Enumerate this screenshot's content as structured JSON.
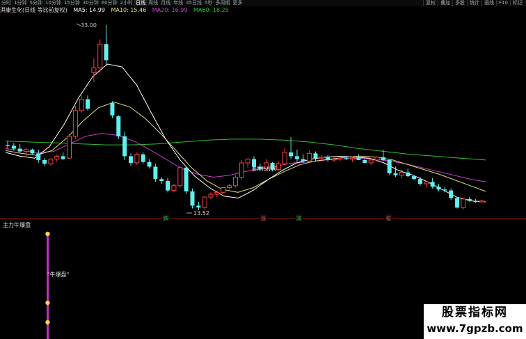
{
  "toolbar": {
    "tabs": [
      "分时",
      "1分钟",
      "5分钟",
      "10分钟",
      "15分钟",
      "30分钟",
      "60分钟",
      "2小时",
      "日线",
      "周线",
      "月线",
      "年线",
      "45日线",
      "5秒",
      "多周期",
      "更多"
    ],
    "active_tab": 8,
    "right_buttons": [
      "复权",
      "叠加",
      "多股",
      "统计",
      "画线",
      "F10",
      "标记"
    ]
  },
  "legend": {
    "stock_name": "湃康生化(日线 等比前复权)",
    "ma5": "MA5: 14.99",
    "ma10": "MA10: 15.46",
    "ma20": "MA20: 16.99",
    "ma60": "MA60: 18.25",
    "colors": {
      "ma5": "#ffffff",
      "ma10": "#e8e07a",
      "ma20": "#d040d0",
      "ma60": "#30c030"
    }
  },
  "annotations": {
    "high_label": "33.00",
    "low_label": "13.52",
    "watermark_small": "股神指标网"
  },
  "signals": [
    {
      "text": "跌",
      "color": "#30c030"
    },
    {
      "text": "涨",
      "color": "#e05050"
    },
    {
      "text": "减",
      "color": "#30c030"
    },
    {
      "text": "稳",
      "color": "#e05050"
    }
  ],
  "indicator": {
    "title": "主力牛爆盘",
    "label": "\"牛爆盘\"",
    "bar_color": "#c030c0"
  },
  "watermark": {
    "line1": "股票指标网",
    "line2": "www.7gpzb.com"
  },
  "chart_data": {
    "type": "candlestick",
    "up_color": "#ff4040",
    "down_color": "#60f0f0",
    "highest_label": 33.0,
    "lowest_label": 13.52,
    "ohlc": [
      [
        20.4,
        20.8,
        20.0,
        20.3
      ],
      [
        20.3,
        20.6,
        19.8,
        20.0
      ],
      [
        20.0,
        20.5,
        19.6,
        19.7
      ],
      [
        19.7,
        20.1,
        19.2,
        19.9
      ],
      [
        19.9,
        20.0,
        19.4,
        19.5
      ],
      [
        19.5,
        19.9,
        18.5,
        18.8
      ],
      [
        18.8,
        19.0,
        18.2,
        18.4
      ],
      [
        18.4,
        19.0,
        18.2,
        18.9
      ],
      [
        18.9,
        19.4,
        18.6,
        19.2
      ],
      [
        19.2,
        19.6,
        18.8,
        18.9
      ],
      [
        19.0,
        21.5,
        18.9,
        21.3
      ],
      [
        21.3,
        24.5,
        21.0,
        24.0
      ],
      [
        24.0,
        25.6,
        23.8,
        25.2
      ],
      [
        25.2,
        25.6,
        24.0,
        24.2
      ],
      [
        28.0,
        29.5,
        27.0,
        28.5
      ],
      [
        28.5,
        31.5,
        28.0,
        31.0
      ],
      [
        31.0,
        33.0,
        28.8,
        29.3
      ],
      [
        24.8,
        25.0,
        23.2,
        23.5
      ],
      [
        23.4,
        23.5,
        21.0,
        21.3
      ],
      [
        21.3,
        21.8,
        18.8,
        19.2
      ],
      [
        19.2,
        19.5,
        18.2,
        18.5
      ],
      [
        18.5,
        19.6,
        18.3,
        19.4
      ],
      [
        19.4,
        19.6,
        18.4,
        18.6
      ],
      [
        18.6,
        18.9,
        17.9,
        18.1
      ],
      [
        18.1,
        18.4,
        16.5,
        16.8
      ],
      [
        16.8,
        17.0,
        16.3,
        16.6
      ],
      [
        16.6,
        16.9,
        15.4,
        15.6
      ],
      [
        15.6,
        16.3,
        15.4,
        16.1
      ],
      [
        16.1,
        18.1,
        15.9,
        18.0
      ],
      [
        18.0,
        18.1,
        15.2,
        15.5
      ],
      [
        15.5,
        15.8,
        13.7,
        14.0
      ],
      [
        14.0,
        14.4,
        13.52,
        13.8
      ],
      [
        13.8,
        15.0,
        13.6,
        14.9
      ],
      [
        14.9,
        15.4,
        14.7,
        15.2
      ],
      [
        15.2,
        15.6,
        14.9,
        15.4
      ],
      [
        15.4,
        16.0,
        15.2,
        15.9
      ],
      [
        15.9,
        16.3,
        15.7,
        16.1
      ],
      [
        16.1,
        17.2,
        15.9,
        17.0
      ],
      [
        17.0,
        18.8,
        16.8,
        18.5
      ],
      [
        18.5,
        19.0,
        18.0,
        18.9
      ],
      [
        18.9,
        19.2,
        17.8,
        18.1
      ],
      [
        18.1,
        18.4,
        17.6,
        17.9
      ],
      [
        17.9,
        18.9,
        17.7,
        18.5
      ],
      [
        18.5,
        18.6,
        17.6,
        17.8
      ],
      [
        17.8,
        18.6,
        17.7,
        18.4
      ],
      [
        18.4,
        20.1,
        18.2,
        19.6
      ],
      [
        19.6,
        21.2,
        18.9,
        19.2
      ],
      [
        19.2,
        19.9,
        18.6,
        18.9
      ],
      [
        18.9,
        19.4,
        18.5,
        18.7
      ],
      [
        18.7,
        19.8,
        18.5,
        19.5
      ],
      [
        19.5,
        19.7,
        18.7,
        19.0
      ],
      [
        19.0,
        19.3,
        18.8,
        19.1
      ],
      [
        19.1,
        19.3,
        18.6,
        18.8
      ],
      [
        18.8,
        19.1,
        18.6,
        18.9
      ],
      [
        18.9,
        19.2,
        18.7,
        19.0
      ],
      [
        19.0,
        19.1,
        18.8,
        18.9
      ],
      [
        18.9,
        19.2,
        18.6,
        19.0
      ],
      [
        19.0,
        19.4,
        18.8,
        18.8
      ],
      [
        18.8,
        18.9,
        18.4,
        18.5
      ],
      [
        18.5,
        19.0,
        18.3,
        18.8
      ],
      [
        18.8,
        19.2,
        18.6,
        19.1
      ],
      [
        19.1,
        19.9,
        18.7,
        18.8
      ],
      [
        18.8,
        18.9,
        17.2,
        17.4
      ],
      [
        17.4,
        18.1,
        17.0,
        17.2
      ],
      [
        17.2,
        17.8,
        16.9,
        17.5
      ],
      [
        17.5,
        17.9,
        17.0,
        17.1
      ],
      [
        17.1,
        17.2,
        16.7,
        16.8
      ],
      [
        16.8,
        17.0,
        16.1,
        16.3
      ],
      [
        16.3,
        16.6,
        15.9,
        16.5
      ],
      [
        16.5,
        16.9,
        15.8,
        16.0
      ],
      [
        16.0,
        16.3,
        15.5,
        15.7
      ],
      [
        15.7,
        16.0,
        15.4,
        15.6
      ],
      [
        15.6,
        15.8,
        14.6,
        14.8
      ],
      [
        14.8,
        14.9,
        13.7,
        13.8
      ],
      [
        13.8,
        14.8,
        13.6,
        14.7
      ],
      [
        14.7,
        14.9,
        14.4,
        14.5
      ],
      [
        14.5,
        14.7,
        14.3,
        14.4
      ],
      [
        14.4,
        14.6,
        14.3,
        14.5
      ]
    ],
    "ma_lines": {
      "MA60": [
        20.8,
        20.7,
        20.6,
        20.5,
        20.4,
        20.4,
        20.5,
        20.7,
        20.9,
        21.0,
        21.0,
        20.9,
        20.7,
        20.4,
        20.0,
        19.7,
        19.4,
        19.2,
        19.0,
        18.8
      ],
      "MA20": [
        20.0,
        19.8,
        19.6,
        19.7,
        20.5,
        21.3,
        21.6,
        21.4,
        20.8,
        19.9,
        18.9,
        17.9,
        17.3,
        17.0,
        17.2,
        17.6,
        17.9,
        18.2,
        18.5,
        18.6,
        18.8,
        18.9,
        19.0,
        18.9,
        18.7,
        18.4,
        18.0,
        17.6,
        17.2,
        16.8,
        16.5
      ],
      "MA10": [
        19.8,
        19.5,
        19.3,
        19.8,
        21.2,
        22.9,
        24.3,
        24.9,
        24.4,
        23.2,
        21.6,
        19.8,
        18.0,
        16.6,
        15.7,
        15.4,
        15.9,
        16.8,
        17.6,
        18.3,
        18.7,
        18.9,
        19.1,
        19.2,
        19.1,
        18.8,
        18.3,
        17.8,
        17.3,
        16.7,
        16.1,
        15.5
      ],
      "MA5": [
        19.6,
        19.2,
        19.0,
        20.2,
        22.5,
        25.3,
        27.6,
        28.9,
        28.6,
        26.7,
        23.8,
        21.0,
        18.8,
        17.1,
        15.9,
        15.0,
        14.8,
        15.6,
        16.7,
        17.7,
        18.5,
        18.9,
        19.1,
        19.2,
        19.1,
        19.0,
        18.5,
        17.7,
        17.2,
        16.5,
        15.7,
        14.9,
        14.5,
        14.4
      ]
    }
  }
}
